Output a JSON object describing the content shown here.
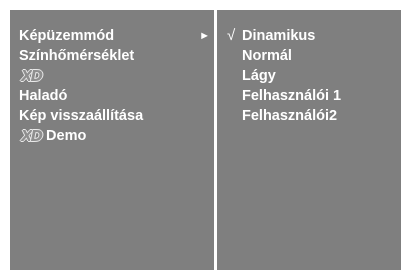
{
  "left_menu": {
    "items": [
      {
        "label": "Képüzemmód",
        "submenu_icon": "►"
      },
      {
        "label": "Színhőmérséklet"
      },
      {
        "logo": "XD"
      },
      {
        "label": "Haladó"
      },
      {
        "label": "Kép visszaállítása"
      },
      {
        "logo": "XD",
        "label": "Demo"
      }
    ]
  },
  "right_menu": {
    "check_mark": "√",
    "items": [
      {
        "label": "Dinamikus",
        "selected": true
      },
      {
        "label": "Normál"
      },
      {
        "label": "Lágy"
      },
      {
        "label": "Felhasználói 1"
      },
      {
        "label": "Felhasználói2"
      }
    ]
  },
  "colors": {
    "background": "#ffffff",
    "panel": "#7f7f7f",
    "text": "#ffffff"
  }
}
